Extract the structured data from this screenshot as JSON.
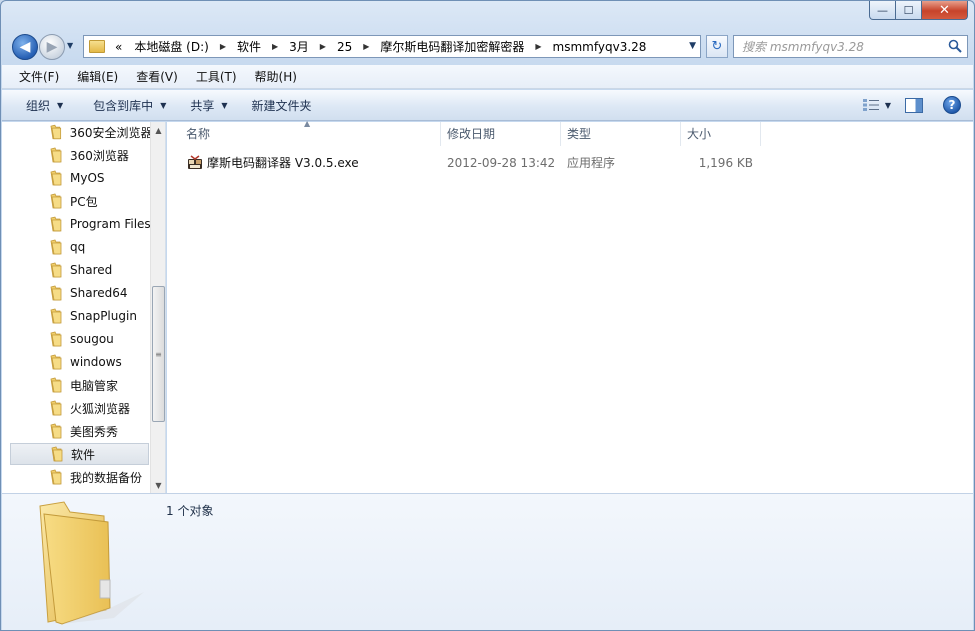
{
  "window": {
    "caption_buttons": {
      "minimize": "—",
      "maximize": "☐",
      "close": "✕"
    }
  },
  "nav": {
    "back_label": "◀",
    "forward_label": "▶",
    "history_label": "▼",
    "breadcrumb": [
      {
        "label": "«"
      },
      {
        "label": "本地磁盘 (D:)"
      },
      {
        "label": "软件"
      },
      {
        "label": "3月"
      },
      {
        "label": "25"
      },
      {
        "label": "摩尔斯电码翻译加密解密器"
      },
      {
        "label": "msmmfyqv3.28"
      }
    ],
    "crumb_separator": "▶",
    "address_dropdown": "▼",
    "refresh_label": "↻",
    "search_placeholder": "搜索 msmmfyqv3.28"
  },
  "menubar": {
    "items": [
      {
        "label": "文件(F)"
      },
      {
        "label": "编辑(E)"
      },
      {
        "label": "查看(V)"
      },
      {
        "label": "工具(T)"
      },
      {
        "label": "帮助(H)"
      }
    ]
  },
  "toolbar": {
    "organize_label": "组织",
    "include_library_label": "包含到库中",
    "share_label": "共享",
    "new_folder_label": "新建文件夹",
    "dropdown_arrow": "▼",
    "help_label": "?"
  },
  "tree": {
    "items": [
      {
        "label": "360安全浏览器"
      },
      {
        "label": "360浏览器"
      },
      {
        "label": "MyOS"
      },
      {
        "label": "PC包"
      },
      {
        "label": "Program Files"
      },
      {
        "label": "qq"
      },
      {
        "label": "Shared"
      },
      {
        "label": "Shared64"
      },
      {
        "label": "SnapPlugin"
      },
      {
        "label": "sougou"
      },
      {
        "label": "windows"
      },
      {
        "label": "电脑管家"
      },
      {
        "label": "火狐浏览器"
      },
      {
        "label": "美图秀秀"
      },
      {
        "label": "软件",
        "selected": true
      },
      {
        "label": "我的数据备份"
      }
    ],
    "scroll_up": "▲",
    "scroll_down": "▼",
    "thumb_grip": "≡"
  },
  "columns": {
    "name": "名称",
    "modified": "修改日期",
    "type": "类型",
    "size": "大小",
    "sort_indicator": "▲"
  },
  "files": [
    {
      "name": "摩斯电码翻译器 V3.0.5.exe",
      "modified": "2012-09-28 13:42",
      "type": "应用程序",
      "size": "1,196 KB"
    }
  ],
  "details": {
    "item_count": "1 个对象"
  },
  "colors": {
    "accent": "#2760b4",
    "folder": "#e8c157",
    "chrome": "#c5d8ee"
  }
}
